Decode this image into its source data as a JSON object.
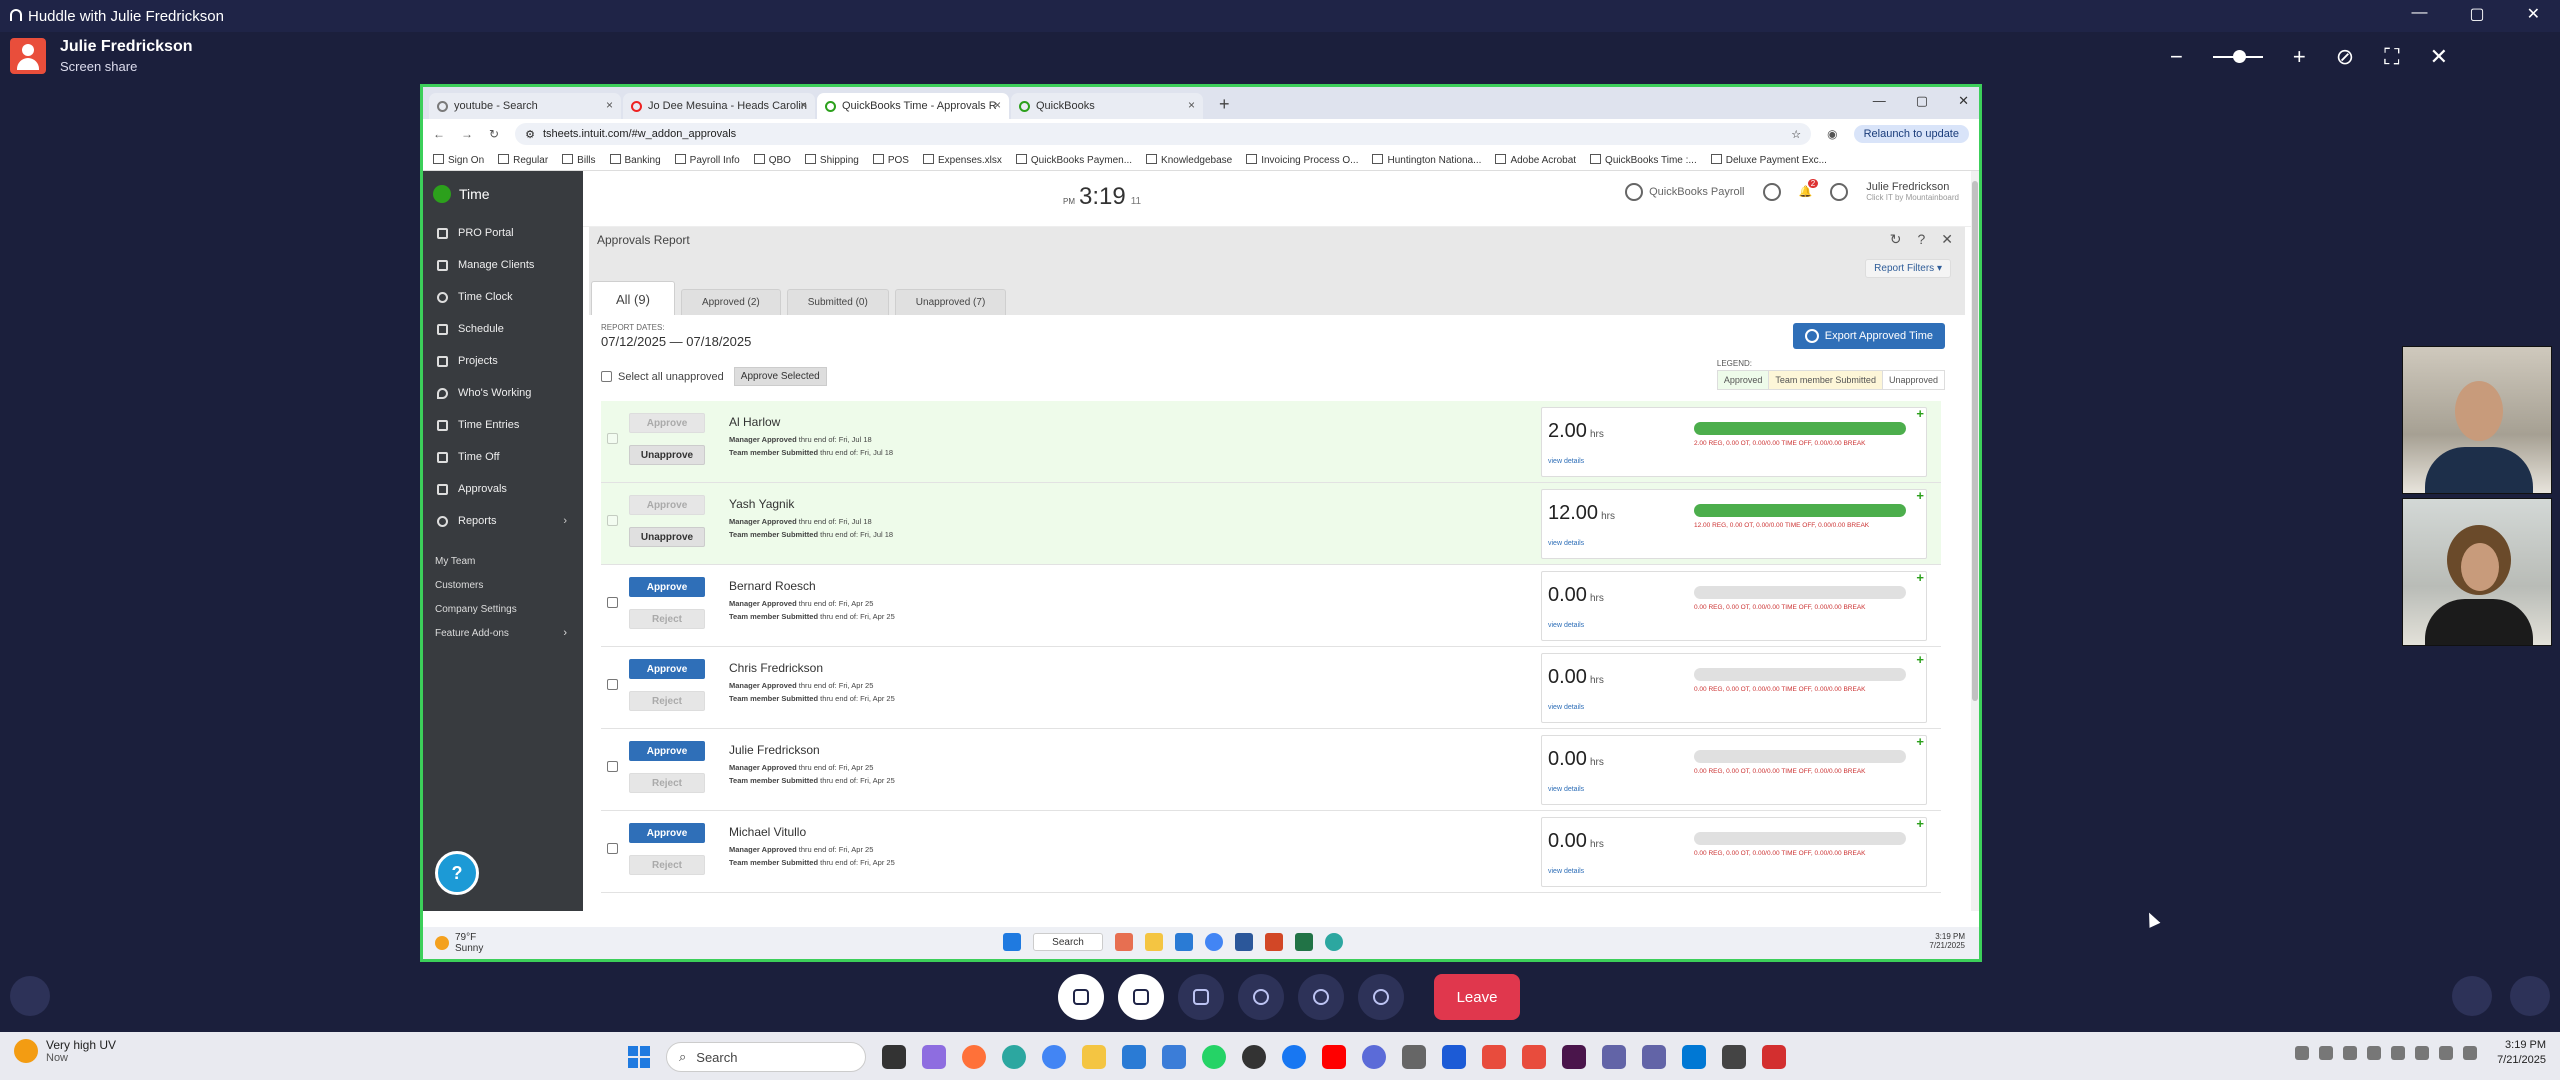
{
  "huddle": {
    "title": "Huddle with Julie Fredrickson",
    "presenter_name": "Julie Fredrickson",
    "presenter_status": "Screen share",
    "zoom_minus": "−",
    "zoom_plus": "+"
  },
  "window_controls": {
    "minimize": "—",
    "restore": "▢",
    "close": "✕"
  },
  "browser": {
    "tabs": [
      {
        "label": "youtube - Search"
      },
      {
        "label": "Jo Dee Mesuina - Heads Carolin"
      },
      {
        "label": "QuickBooks Time - Approvals R"
      },
      {
        "label": "QuickBooks"
      }
    ],
    "active_tab": 2,
    "url": "tsheets.intuit.com/#w_addon_approvals",
    "relaunch": "Relaunch to update",
    "bookmarks": [
      "Sign On",
      "Regular",
      "Bills",
      "Banking",
      "Payroll Info",
      "QBO",
      "Shipping",
      "POS",
      "Expenses.xlsx",
      "QuickBooks Paymen...",
      "Knowledgebase",
      "Invoicing Process O...",
      "Huntington Nationa...",
      "Adobe Acrobat",
      "QuickBooks Time :...",
      "Deluxe Payment Exc..."
    ]
  },
  "sidebar": {
    "brand": "Time",
    "items": [
      {
        "label": "PRO Portal",
        "icon": "monitor-icon"
      },
      {
        "label": "Manage Clients",
        "icon": "people-icon"
      },
      {
        "label": "Time Clock",
        "icon": "clock-icon"
      },
      {
        "label": "Schedule",
        "icon": "calendar-icon"
      },
      {
        "label": "Projects",
        "icon": "chart-icon"
      },
      {
        "label": "Who's Working",
        "icon": "pin-icon"
      },
      {
        "label": "Time Entries",
        "icon": "list-icon"
      },
      {
        "label": "Time Off",
        "icon": "plane-icon"
      },
      {
        "label": "Approvals",
        "icon": "check-icon"
      },
      {
        "label": "Reports",
        "icon": "pie-icon"
      }
    ],
    "sub_items": [
      "My Team",
      "Customers",
      "Company Settings",
      "Feature Add-ons"
    ],
    "help": "?"
  },
  "topbar": {
    "ampm": "PM",
    "time": "3:19",
    "seconds": "11",
    "payroll": "QuickBooks Payroll",
    "notifications": "2",
    "user_name": "Julie Fredrickson",
    "user_sub": "Click IT by Mountainboard"
  },
  "report": {
    "title": "Approvals Report",
    "filters": "Report Filters",
    "tabs": [
      "All (9)",
      "Approved (2)",
      "Submitted (0)",
      "Unapproved (7)"
    ],
    "dates_label": "REPORT DATES:",
    "dates": "07/12/2025 — 07/18/2025",
    "select_all": "Select all unapproved",
    "approve_selected": "Approve Selected",
    "export": "Export Approved Time",
    "legend_label": "LEGEND:",
    "legend": [
      "Approved",
      "Team member Submitted",
      "Unapproved"
    ],
    "rows": [
      {
        "name": "Al Harlow",
        "mgr": "Manager Approved",
        "mgr_rest": " thru end of: Fri, Jul 18",
        "tm": "Team member Submitted",
        "tm_rest": " thru end of: Fri, Jul 18",
        "hours": "2.00",
        "unit": "hrs",
        "details": "view details",
        "breakdown": "2.00 REG, 0.00 OT, 0.00/0.00 TIME OFF, 0.00/0.00 BREAK",
        "btn1": "Approve",
        "btn2": "Unapprove",
        "approved": true,
        "fill": 1
      },
      {
        "name": "Yash Yagnik",
        "mgr": "Manager Approved",
        "mgr_rest": " thru end of: Fri, Jul 18",
        "tm": "Team member Submitted",
        "tm_rest": " thru end of: Fri, Jul 18",
        "hours": "12.00",
        "unit": "hrs",
        "details": "view details",
        "breakdown": "12.00 REG, 0.00 OT, 0.00/0.00 TIME OFF, 0.00/0.00 BREAK",
        "btn1": "Approve",
        "btn2": "Unapprove",
        "approved": true,
        "fill": 1
      },
      {
        "name": "Bernard Roesch",
        "mgr": "Manager Approved",
        "mgr_rest": " thru end of: Fri, Apr 25",
        "tm": "Team member Submitted",
        "tm_rest": " thru end of: Fri, Apr 25",
        "hours": "0.00",
        "unit": "hrs",
        "details": "view details",
        "breakdown": "0.00 REG, 0.00 OT, 0.00/0.00 TIME OFF, 0.00/0.00 BREAK",
        "btn1": "Approve",
        "btn2": "Reject",
        "approved": false,
        "fill": 0
      },
      {
        "name": "Chris Fredrickson",
        "mgr": "Manager Approved",
        "mgr_rest": " thru end of: Fri, Apr 25",
        "tm": "Team member Submitted",
        "tm_rest": " thru end of: Fri, Apr 25",
        "hours": "0.00",
        "unit": "hrs",
        "details": "view details",
        "breakdown": "0.00 REG, 0.00 OT, 0.00/0.00 TIME OFF, 0.00/0.00 BREAK",
        "btn1": "Approve",
        "btn2": "Reject",
        "approved": false,
        "fill": 0
      },
      {
        "name": "Julie Fredrickson",
        "mgr": "Manager Approved",
        "mgr_rest": " thru end of: Fri, Apr 25",
        "tm": "Team member Submitted",
        "tm_rest": " thru end of: Fri, Apr 25",
        "hours": "0.00",
        "unit": "hrs",
        "details": "view details",
        "breakdown": "0.00 REG, 0.00 OT, 0.00/0.00 TIME OFF, 0.00/0.00 BREAK",
        "btn1": "Approve",
        "btn2": "Reject",
        "approved": false,
        "fill": 0
      },
      {
        "name": "Michael Vitullo",
        "mgr": "Manager Approved",
        "mgr_rest": " thru end of: Fri, Apr 25",
        "tm": "Team member Submitted",
        "tm_rest": " thru end of: Fri, Apr 25",
        "hours": "0.00",
        "unit": "hrs",
        "details": "view details",
        "breakdown": "0.00 REG, 0.00 OT, 0.00/0.00 TIME OFF, 0.00/0.00 BREAK",
        "btn1": "Approve",
        "btn2": "Reject",
        "approved": false,
        "fill": 0
      }
    ]
  },
  "remote_taskbar": {
    "temp": "79°F",
    "cond": "Sunny",
    "search": "Search",
    "time": "3:19 PM",
    "date": "7/21/2025"
  },
  "meeting_controls": {
    "leave": "Leave"
  },
  "taskbar": {
    "weather_title": "Very high UV",
    "weather_sub": "Now",
    "search": "Search",
    "time": "3:19 PM",
    "date": "7/21/2025"
  }
}
